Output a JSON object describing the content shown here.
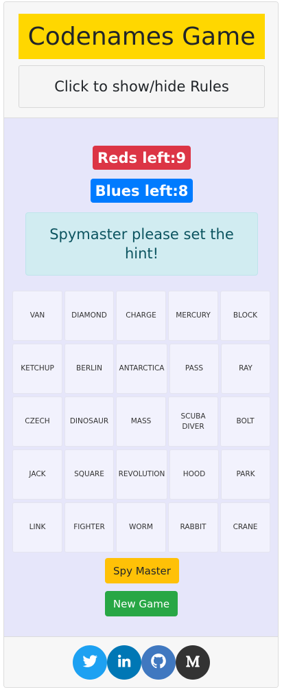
{
  "header": {
    "title": "Codenames Game",
    "rules_button": "Click to show/hide Rules"
  },
  "status": {
    "reds_left": "Reds left:9",
    "blues_left": "Blues left:8",
    "hint_message": "Spymaster please set the hint!"
  },
  "board": [
    [
      "VAN",
      "DIAMOND",
      "CHARGE",
      "MERCURY",
      "BLOCK"
    ],
    [
      "KETCHUP",
      "BERLIN",
      "ANTARCTICA",
      "PASS",
      "RAY"
    ],
    [
      "CZECH",
      "DINOSAUR",
      "MASS",
      "SCUBA DIVER",
      "BOLT"
    ],
    [
      "JACK",
      "SQUARE",
      "REVOLUTION",
      "HOOD",
      "PARK"
    ],
    [
      "LINK",
      "FIGHTER",
      "WORM",
      "RABBIT",
      "CRANE"
    ]
  ],
  "buttons": {
    "spy_master": "Spy Master",
    "new_game": "New Game"
  },
  "colors": {
    "title_bg": "#ffd700",
    "reds": "#dc3545",
    "blues": "#007bff",
    "board_bg": "#e6e6fa",
    "hint_bg": "#d1ecf1",
    "spy_master": "#ffc107",
    "new_game": "#28a745"
  },
  "social": {
    "items": [
      {
        "icon": "twitter-icon"
      },
      {
        "icon": "linkedin-icon"
      },
      {
        "icon": "github-icon"
      },
      {
        "icon": "medium-icon"
      }
    ]
  }
}
